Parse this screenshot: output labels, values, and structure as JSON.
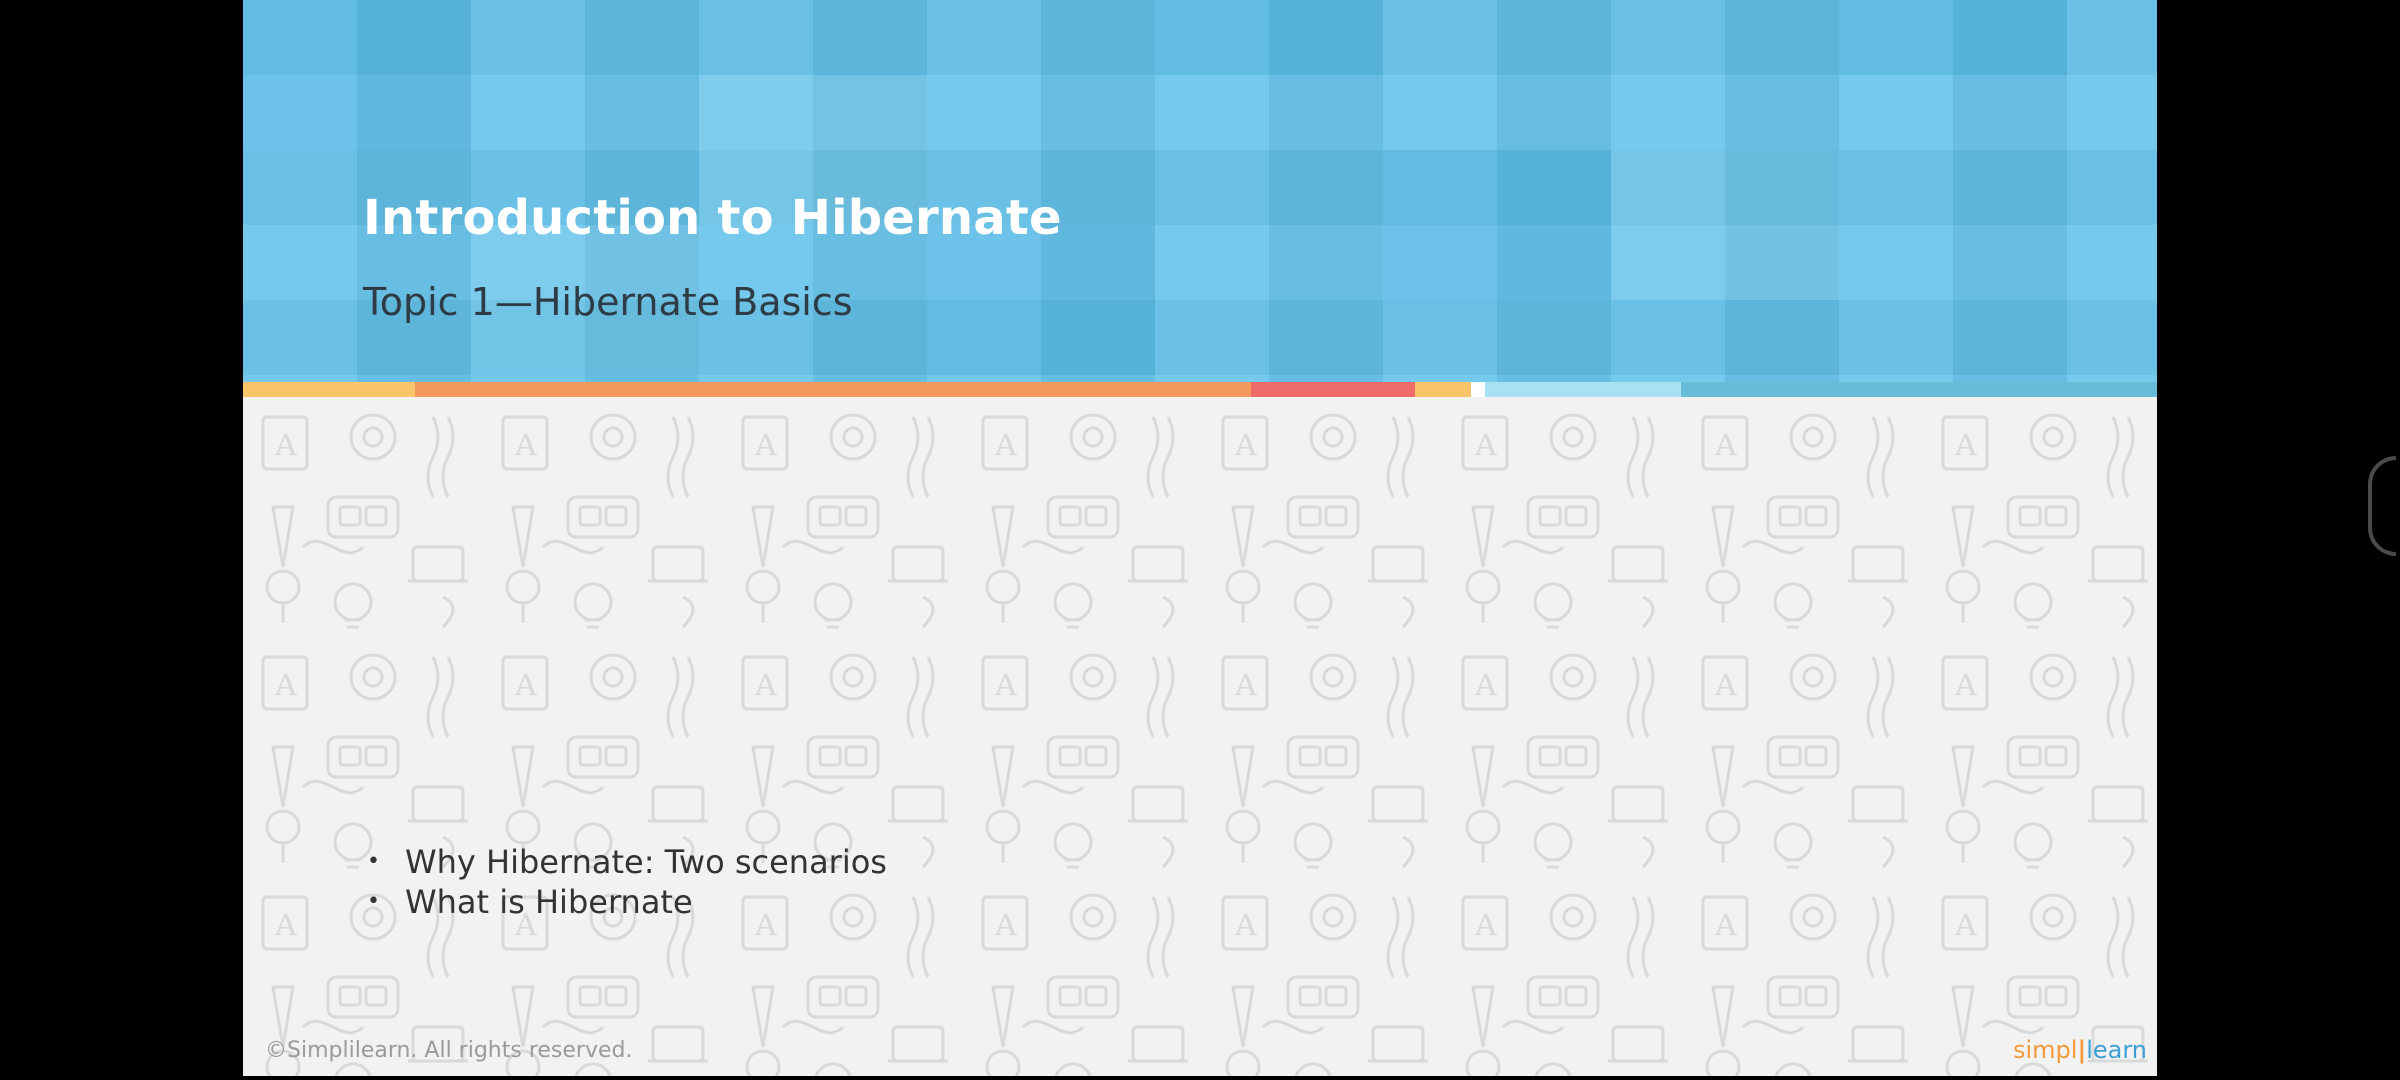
{
  "slide": {
    "title": "Introduction to Hibernate",
    "subtitle": "Topic 1—Hibernate  Basics",
    "bullets": [
      "Why Hibernate: Two scenarios",
      "What is Hibernate"
    ],
    "bullet_glyph": "•",
    "copyright": "©Simplilearn. All rights reserved.",
    "logo": {
      "part1": "simpl",
      "separator": "|",
      "part2": "learn"
    }
  },
  "colors": {
    "banner": "#64c3ea",
    "stripe_yellow": "#f9c46a",
    "stripe_orange": "#f4985c",
    "stripe_red": "#ee6b6a",
    "stripe_light_blue": "#a9e0f2",
    "stripe_teal": "#67bcd8",
    "title_text": "#ffffff",
    "subtitle_text": "#2f3b44"
  },
  "icons": {
    "edge_handle": "edge-swipe-handle-icon",
    "background_pattern": "doodle-pattern"
  }
}
